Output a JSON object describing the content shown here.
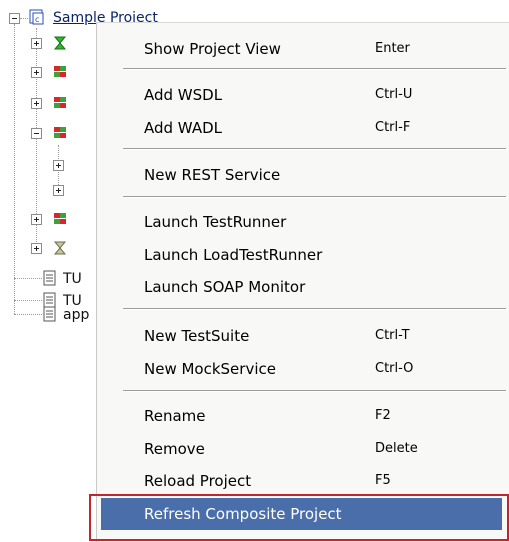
{
  "tree": {
    "root_label": "Sample Project",
    "partial_labels": [
      "TU",
      "TU",
      "app"
    ]
  },
  "menu": {
    "items": [
      {
        "label": "Show Project View",
        "shortcut": "Enter"
      },
      {
        "label": "Add WSDL",
        "shortcut": "Ctrl-U"
      },
      {
        "label": "Add WADL",
        "shortcut": "Ctrl-F"
      },
      {
        "label": "New REST Service",
        "shortcut": ""
      },
      {
        "label": "Launch TestRunner",
        "shortcut": ""
      },
      {
        "label": "Launch LoadTestRunner",
        "shortcut": ""
      },
      {
        "label": "Launch SOAP Monitor",
        "shortcut": ""
      },
      {
        "label": "New TestSuite",
        "shortcut": "Ctrl-T"
      },
      {
        "label": "New MockService",
        "shortcut": "Ctrl-O"
      },
      {
        "label": "Rename",
        "shortcut": "F2"
      },
      {
        "label": "Remove",
        "shortcut": "Delete"
      },
      {
        "label": "Reload Project",
        "shortcut": "F5"
      },
      {
        "label": "Refresh Composite Project",
        "shortcut": ""
      }
    ]
  },
  "colors": {
    "highlight": "#4a6ea9",
    "callout_border": "#c0262c"
  }
}
